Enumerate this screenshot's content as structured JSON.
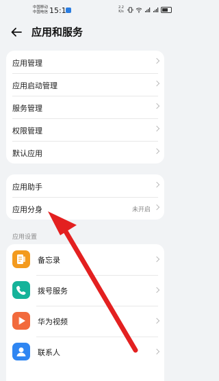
{
  "status": {
    "carrier1": "中国移动",
    "carrier2": "中国电信",
    "time": "15:10",
    "net_speed": "2.2",
    "net_unit": "K/s",
    "battery_percent": 65
  },
  "header": {
    "title": "应用和服务"
  },
  "group1": [
    {
      "label": "应用管理"
    },
    {
      "label": "应用启动管理"
    },
    {
      "label": "服务管理"
    },
    {
      "label": "权限管理"
    },
    {
      "label": "默认应用"
    }
  ],
  "group2": [
    {
      "label": "应用助手"
    },
    {
      "label": "应用分身",
      "value": "未开启"
    }
  ],
  "section": {
    "label": "应用设置"
  },
  "apps": [
    {
      "label": "备忘录",
      "icon": "memo-icon",
      "color": "#f39a1e"
    },
    {
      "label": "拨号服务",
      "icon": "phone-icon",
      "color": "#16b39a"
    },
    {
      "label": "华为视频",
      "icon": "video-icon",
      "color": "#f26a3c"
    },
    {
      "label": "联系人",
      "icon": "contacts-icon",
      "color": "#2f86f2"
    }
  ],
  "colors": {
    "background": "#f1f3f5",
    "arrow": "#e32020"
  }
}
